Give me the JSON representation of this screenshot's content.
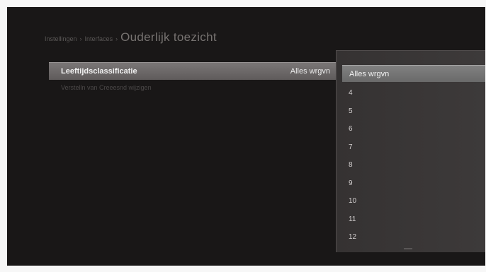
{
  "breadcrumb": {
    "level1": "Instellingen",
    "separator": "›",
    "level2": "Interfaces",
    "current": "Ouderlijk toezicht"
  },
  "settings": {
    "age_rating": {
      "label": "Leeftijdsclassificatie",
      "value": "Alles wrgvn"
    },
    "secondary_item": "Verstelln van Creeesnd wijzigen"
  },
  "dropdown": {
    "selected": "Alles wrgvn",
    "options": [
      "4",
      "5",
      "6",
      "7",
      "8",
      "9",
      "10",
      "11",
      "12"
    ]
  }
}
